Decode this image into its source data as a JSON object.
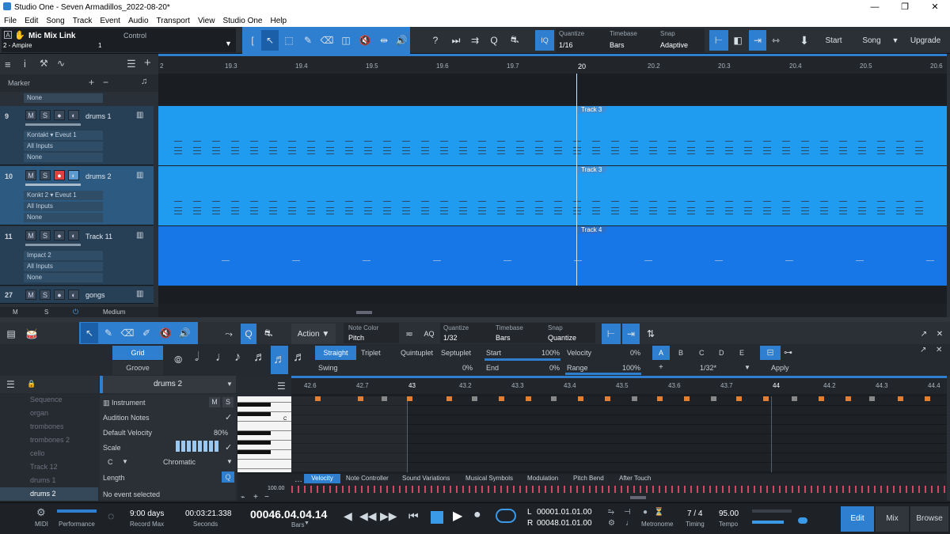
{
  "titlebar": {
    "title": "Studio One - Seven Armadillos_2022-08-20*",
    "minimize": "—",
    "restore": "❐",
    "close": "✕"
  },
  "menu": [
    "File",
    "Edit",
    "Song",
    "Track",
    "Event",
    "Audio",
    "Transport",
    "View",
    "Studio One",
    "Help"
  ],
  "toolbar": {
    "channel_label": "A",
    "track_name": "Mic Mix Link",
    "track_sub": "2 - Ampire",
    "control_label": "Control",
    "control_value": "1",
    "iq_label": "IQ",
    "quantize_label": "Quantize",
    "quantize_value": "1/16",
    "timebase_label": "Timebase",
    "timebase_value": "Bars",
    "snap_label": "Snap",
    "snap_value": "Adaptive",
    "start_label": "Start",
    "song_label": "Song",
    "upgrade_label": "Upgrade"
  },
  "tracklist": {
    "marker_label": "Marker",
    "top_none": "None",
    "tracks": [
      {
        "num": "9",
        "name": "drums 1",
        "inst": "Kontakt",
        "outname": "Eveut 1",
        "input": "All Inputs",
        "none": "None"
      },
      {
        "num": "10",
        "name": "drums 2",
        "inst": "Konkt 2",
        "outname": "Eveut 1",
        "input": "All Inputs",
        "none": "None"
      },
      {
        "num": "11",
        "name": "Track 11",
        "inst": "Impact 2",
        "input": "All Inputs",
        "none": "None"
      },
      {
        "num": "27",
        "name": "gongs"
      }
    ],
    "footer": {
      "m": "M",
      "s": "S",
      "zoom": "Medium"
    },
    "btn_m": "M",
    "btn_s": "S"
  },
  "ruler": [
    "2",
    "19.3",
    "19.4",
    "19.5",
    "19.6",
    "19.7",
    "20",
    "20.2",
    "20.3",
    "20.4",
    "20.5",
    "20.6"
  ],
  "events": [
    "Track 3",
    "Track 3",
    "Track 4"
  ],
  "editor_tb": {
    "action_label": "Action",
    "note_color_label": "Note Color",
    "note_color_value": "Pitch",
    "aq_label": "AQ",
    "quantize_label": "Quantize",
    "quantize_value": "1/32",
    "timebase_label": "Timebase",
    "timebase_value": "Bars",
    "snap_label": "Snap",
    "snap_value": "Quantize"
  },
  "quant_panel": {
    "grid": "Grid",
    "groove": "Groove",
    "straight": "Straight",
    "triplet": "Triplet",
    "quintuplet": "Quintuplet",
    "septuplet": "Septuplet",
    "swing": "Swing",
    "swing_value": "0%",
    "start": "Start",
    "start_value": "100%",
    "end": "End",
    "end_value": "0%",
    "velocity": "Velocity",
    "velocity_value": "0%",
    "range": "Range",
    "range_value": "100%",
    "slots": [
      "A",
      "B",
      "C",
      "D",
      "E"
    ],
    "plus": "+",
    "slot_value": "1/32*",
    "apply": "Apply"
  },
  "inspector": {
    "track_title": "drums 2",
    "tracks": [
      "Sequence",
      "organ",
      "trombones",
      "trombones 2",
      "cello",
      "Track 12",
      "drums 1",
      "drums 2"
    ],
    "instrument_label": "Instrument",
    "m": "M",
    "s": "S",
    "audition_label": "Audition Notes",
    "default_velocity_label": "Default Velocity",
    "default_velocity_value": "80%",
    "scale_label": "Scale",
    "scale_root": "C",
    "scale_type": "Chromatic",
    "length_label": "Length",
    "no_event": "No event selected",
    "q_label": "Q"
  },
  "piano_roll": {
    "ruler": [
      "42.6",
      "42.7",
      "43",
      "43.2",
      "43.3",
      "43.4",
      "43.5",
      "43.6",
      "43.7",
      "44",
      "44.2",
      "44.3",
      "44.4"
    ],
    "c_label": "C",
    "lane_tabs": [
      "Velocity",
      "Note Controller",
      "Sound Variations",
      "Musical Symbols",
      "Modulation",
      "Pitch Bend",
      "After Touch"
    ],
    "lane_value": "100.00"
  },
  "transport": {
    "midi_label": "MIDI",
    "performance_label": "Performance",
    "record_days": "9:00 days",
    "record_max_label": "Record Max",
    "seconds_value": "00:03:21.338",
    "seconds_label": "Seconds",
    "bars_value": "00046.04.04.14",
    "bars_label": "Bars",
    "loop_l": "L",
    "loop_r": "R",
    "loop_start": "00001.01.01.00",
    "loop_end": "00048.01.01.00",
    "metronome_label": "Metronome",
    "timing_value": "7 / 4",
    "timing_label": "Timing",
    "tempo_value": "95.00",
    "tempo_label": "Tempo",
    "edit": "Edit",
    "mix": "Mix",
    "browse": "Browse"
  },
  "colors": {
    "accent": "#2e7fd0",
    "lane_light": "#1f9bf0",
    "lane_dark": "#1877e6"
  }
}
